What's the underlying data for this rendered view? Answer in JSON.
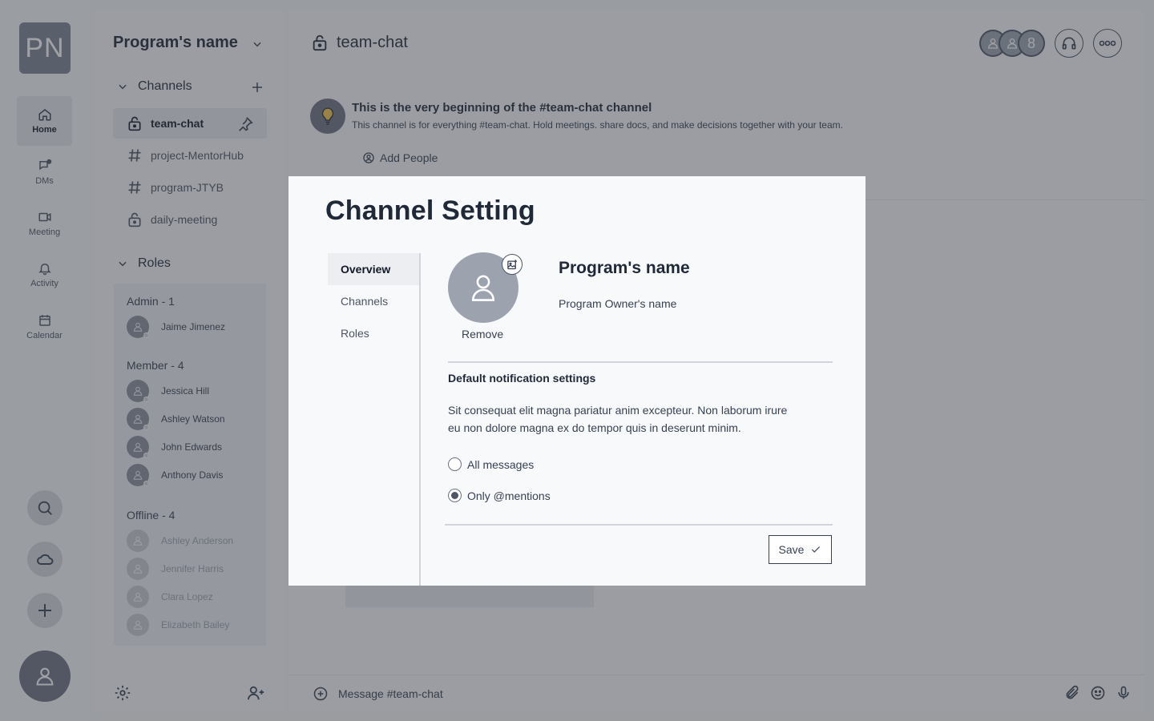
{
  "rail": {
    "logo": "PN",
    "items": [
      {
        "label": "Home"
      },
      {
        "label": "DMs"
      },
      {
        "label": "Meeting"
      },
      {
        "label": "Activity"
      },
      {
        "label": "Calendar"
      }
    ]
  },
  "sidebar": {
    "program_name": "Program's name",
    "channels_heading": "Channels",
    "channels": [
      {
        "name": "team-chat",
        "type": "private"
      },
      {
        "name": "project-MentorHub",
        "type": "public"
      },
      {
        "name": "program-JTYB",
        "type": "public"
      },
      {
        "name": "daily-meeting",
        "type": "private"
      }
    ],
    "roles_heading": "Roles",
    "groups": {
      "admin": {
        "label": "Admin - 1",
        "members": [
          "Jaime Jimenez"
        ]
      },
      "member": {
        "label": "Member - 4",
        "members": [
          "Jessica Hill",
          "Ashley Watson",
          "John Edwards",
          "Anthony Davis"
        ]
      },
      "offline": {
        "label": "Offline - 4",
        "members": [
          "Ashley Anderson",
          "Jennifer Harris",
          "Clara Lopez",
          "Elizabeth Bailey"
        ]
      }
    }
  },
  "main": {
    "channel_title": "team-chat",
    "member_count": "8",
    "intro_title": "This is the very beginning of the #team-chat  channel",
    "intro_sub": "This channel is for everything #team-chat. Hold meetings. share docs, and make decisions together with your team.",
    "add_people": "Add People",
    "composer_placeholder": "Message #team-chat"
  },
  "modal": {
    "title": "Channel Setting",
    "nav": [
      "Overview",
      "Channels",
      "Roles"
    ],
    "remove_label": "Remove",
    "program_name": "Program's name",
    "owner_name": "Program Owner's name",
    "notif_title": "Default notification settings",
    "notif_desc": "Sit consequat elit magna pariatur anim excepteur. Non laborum irure eu non dolore magna ex do tempor quis in deserunt minim.",
    "options": [
      {
        "label": "All messages",
        "selected": false
      },
      {
        "label": "Only @mentions",
        "selected": true
      }
    ],
    "save_label": "Save"
  },
  "colors": {
    "overlay": "#373a42",
    "accent": "#4b5563",
    "bulb": "#f6c34a"
  }
}
